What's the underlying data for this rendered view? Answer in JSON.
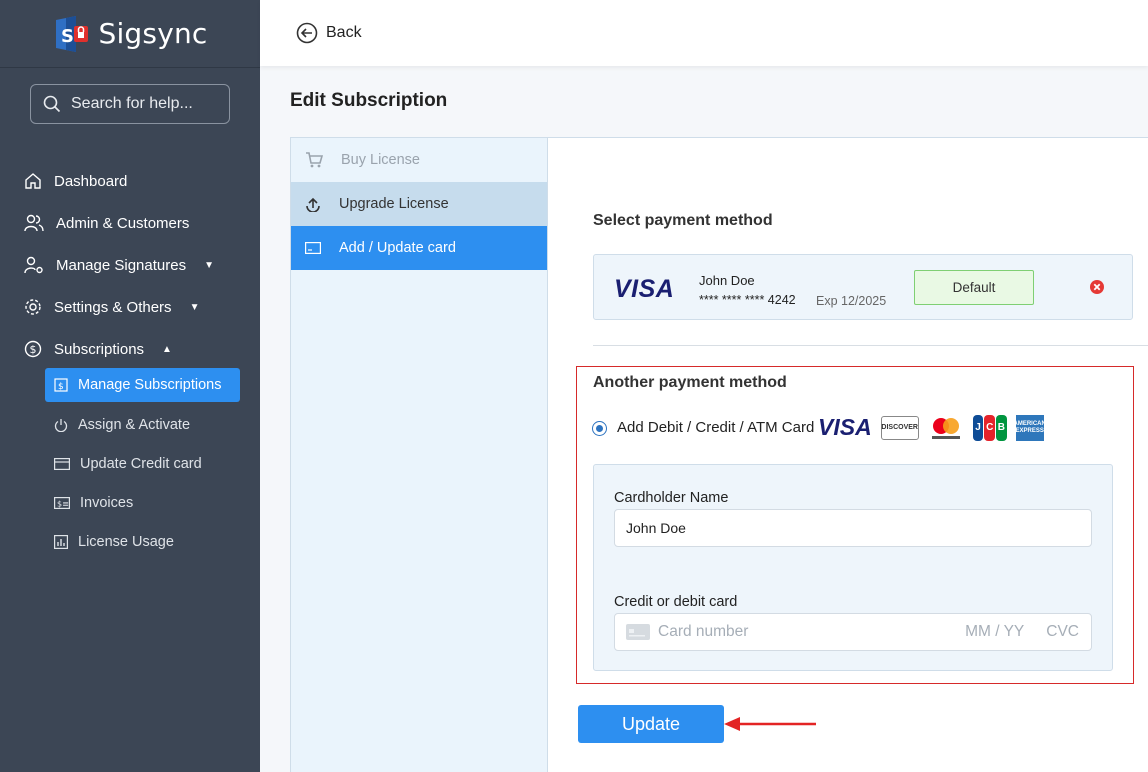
{
  "app": {
    "name": "Sigsync"
  },
  "search": {
    "placeholder": "Search for help..."
  },
  "nav": {
    "dashboard": "Dashboard",
    "admin": "Admin & Customers",
    "signatures": "Manage Signatures",
    "settings": "Settings & Others",
    "subscriptions": "Subscriptions",
    "sub_items": [
      "Manage Subscriptions",
      "Assign & Activate",
      "Update Credit card",
      "Invoices",
      "License Usage"
    ]
  },
  "topbar": {
    "back_label": "Back"
  },
  "page": {
    "title": "Edit Subscription"
  },
  "tabs": [
    "Buy License",
    "Upgrade License",
    "Add / Update card"
  ],
  "payment": {
    "select_title": "Select payment method",
    "saved_card": {
      "brand": "VISA",
      "name": "John Doe",
      "number": "**** **** **** 4242",
      "expiry": "Exp 12/2025",
      "default_label": "Default"
    },
    "another_title": "Another payment method",
    "option_label": "Add Debit / Credit / ATM Card",
    "brand_icons": {
      "visa": "VISA",
      "discover": "DISCOVER",
      "jcb": [
        "J",
        "C",
        "B"
      ],
      "amex": "AMERICAN EXPRESS"
    },
    "cardholder_label": "Cardholder Name",
    "cardholder_value": "John Doe",
    "card_label": "Credit or debit card",
    "card_placeholder": "Card number",
    "card_mm": "MM / YY",
    "card_cvc": "CVC",
    "update_label": "Update"
  },
  "colors": {
    "sidebar": "#3c4655",
    "accent": "#2d8ff0",
    "highlight": "#d62a2a"
  }
}
